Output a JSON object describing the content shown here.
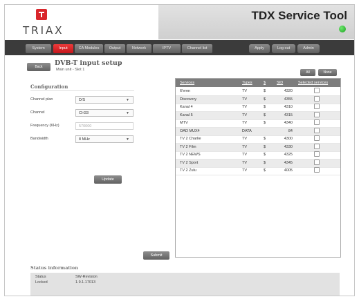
{
  "header": {
    "logo_text": "TRIAX",
    "app_title": "TDX Service Tool",
    "status_led_color": "#1aa11f"
  },
  "nav": {
    "tabs": [
      "System",
      "Input",
      "CA Modules",
      "Output",
      "Network",
      "IPTV",
      "Channel list"
    ],
    "active_tab": "Input",
    "buttons": {
      "apply": "Apply",
      "logout": "Log out",
      "admin": "Admin"
    }
  },
  "page": {
    "back_label": "Back",
    "title": "DVB-T input setup",
    "subtitle": "Main unit - Slot 1"
  },
  "config": {
    "heading": "Configuration",
    "channel_plan": {
      "label": "Channel plan",
      "value": "D/S"
    },
    "channel": {
      "label": "Channel",
      "value": "CH33"
    },
    "frequency": {
      "label": "Frequency (KHz)",
      "placeholder": "570000"
    },
    "bandwidth": {
      "label": "Bandwidth",
      "value": "8 MHz"
    },
    "update_label": "Update",
    "submit_label": "Submit"
  },
  "services": {
    "all_label": "All",
    "none_label": "None",
    "columns": [
      "Services",
      "Types",
      "$",
      "SID",
      "Selected services"
    ],
    "rows": [
      {
        "name": "6'eren",
        "type": "TV",
        "scrambled": "$",
        "sid": "4320"
      },
      {
        "name": "Discovery",
        "type": "TV",
        "scrambled": "$",
        "sid": "4355"
      },
      {
        "name": "Kanal 4",
        "type": "TV",
        "scrambled": "$",
        "sid": "4310"
      },
      {
        "name": "Kanal 5",
        "type": "TV",
        "scrambled": "$",
        "sid": "4315"
      },
      {
        "name": "MTV",
        "type": "TV",
        "scrambled": "$",
        "sid": "4340"
      },
      {
        "name": "OAD MUX4",
        "type": "DATA",
        "scrambled": "",
        "sid": "84"
      },
      {
        "name": "TV 2 Charlie",
        "type": "TV",
        "scrambled": "$",
        "sid": "4300"
      },
      {
        "name": "TV 2 Film",
        "type": "TV",
        "scrambled": "$",
        "sid": "4330"
      },
      {
        "name": "TV 2 NEWS",
        "type": "TV",
        "scrambled": "$",
        "sid": "4325"
      },
      {
        "name": "TV 2 Sport",
        "type": "TV",
        "scrambled": "$",
        "sid": "4345"
      },
      {
        "name": "TV 2 Zulu",
        "type": "TV",
        "scrambled": "$",
        "sid": "4005"
      }
    ]
  },
  "status": {
    "heading": "Status information",
    "col1_label": "Status",
    "col1_value": "Locked",
    "col2_label": "SW-Revision",
    "col2_value": "1.9.1.17013"
  }
}
